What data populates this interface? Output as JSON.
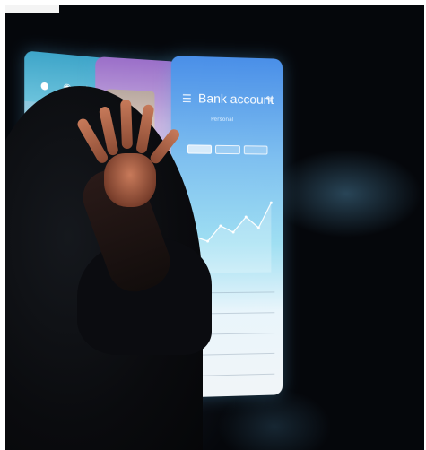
{
  "scene": {
    "description_hidden": ""
  },
  "panels": {
    "map": {
      "icons": [
        "pin-icon",
        "location-icon",
        "person-icon"
      ]
    },
    "profile": {},
    "bank": {
      "title": "Bank account",
      "subtitle": "Personal",
      "tabs": [
        "",
        "",
        ""
      ],
      "chart_points": [
        62,
        50,
        55,
        38,
        45,
        28,
        40,
        12
      ]
    },
    "dock_icons": [
      "phone-icon",
      "search-icon",
      "record-icon",
      "contacts-icon"
    ]
  },
  "colors": {
    "background": "#05070b",
    "bank_accent": "#4a8fe8",
    "map_accent": "#3ea5c9",
    "profile_accent": "#9b6fc9"
  }
}
